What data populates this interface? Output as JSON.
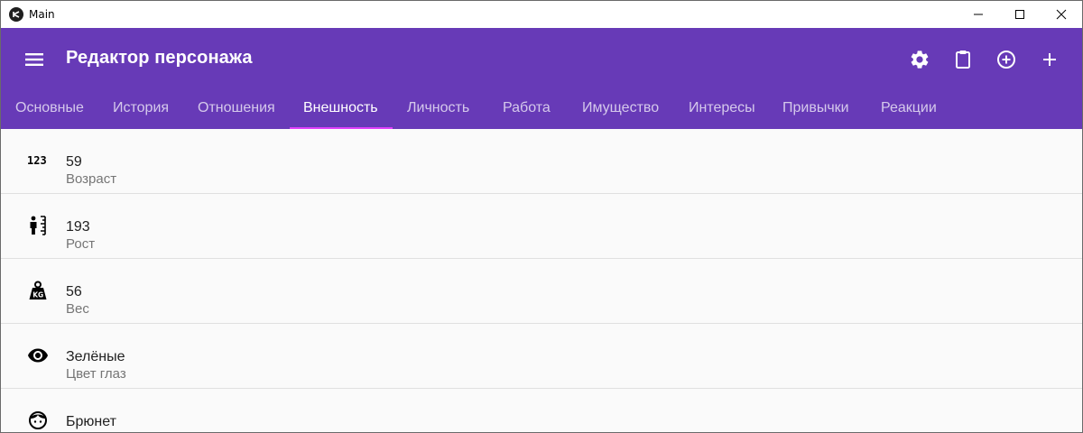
{
  "window": {
    "title": "Main"
  },
  "appbar": {
    "title": "Редактор персонажа",
    "color": "#673ab7",
    "actions": [
      "gear-icon",
      "clipboard-icon",
      "add-circle-icon",
      "plus-icon"
    ]
  },
  "tabs": [
    {
      "label": "Основные",
      "active": false
    },
    {
      "label": "История",
      "active": false
    },
    {
      "label": "Отношения",
      "active": false
    },
    {
      "label": "Внешность",
      "active": true
    },
    {
      "label": "Личность",
      "active": false
    },
    {
      "label": "Работа",
      "active": false
    },
    {
      "label": "Имущество",
      "active": false
    },
    {
      "label": "Интересы",
      "active": false
    },
    {
      "label": "Привычки",
      "active": false
    },
    {
      "label": "Реакции",
      "active": false
    }
  ],
  "list": [
    {
      "icon": "numeric-123-icon",
      "value": "59",
      "label": "Возраст"
    },
    {
      "icon": "human-height-icon",
      "value": "193",
      "label": "Рост"
    },
    {
      "icon": "weight-kg-icon",
      "value": "56",
      "label": "Вес"
    },
    {
      "icon": "eye-icon",
      "value": "Зелёные",
      "label": "Цвет глаз"
    },
    {
      "icon": "face-hair-icon",
      "value": "Брюнет",
      "label": ""
    }
  ]
}
